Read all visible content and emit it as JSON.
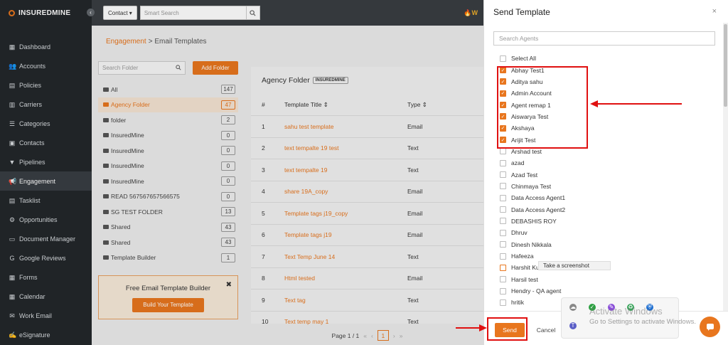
{
  "app": {
    "logo_bold": "INSUREDMINE",
    "logo_thin": "",
    "collapse_icon": "chevron-left"
  },
  "sidebar": {
    "items": [
      {
        "label": "Dashboard",
        "icon": "dashboard-icon",
        "glyph": "▦"
      },
      {
        "label": "Accounts",
        "icon": "users-icon",
        "glyph": "👥"
      },
      {
        "label": "Policies",
        "icon": "document-icon",
        "glyph": "▤"
      },
      {
        "label": "Carriers",
        "icon": "building-icon",
        "glyph": "▥"
      },
      {
        "label": "Categories",
        "icon": "category-icon",
        "glyph": "☰"
      },
      {
        "label": "Contacts",
        "icon": "contact-icon",
        "glyph": "▣"
      },
      {
        "label": "Pipelines",
        "icon": "funnel-icon",
        "glyph": "▼"
      },
      {
        "label": "Engagement",
        "icon": "megaphone-icon",
        "glyph": "📢"
      },
      {
        "label": "Tasklist",
        "icon": "tasklist-icon",
        "glyph": "▤"
      },
      {
        "label": "Opportunities",
        "icon": "opportunity-icon",
        "glyph": "⚙"
      },
      {
        "label": "Document Manager",
        "icon": "folder-icon",
        "glyph": "▭"
      },
      {
        "label": "Google Reviews",
        "icon": "google-icon",
        "glyph": "G"
      },
      {
        "label": "Forms",
        "icon": "forms-icon",
        "glyph": "▦"
      },
      {
        "label": "Calendar",
        "icon": "calendar-icon",
        "glyph": "▦"
      },
      {
        "label": "Work Email",
        "icon": "email-icon",
        "glyph": "✉"
      },
      {
        "label": "eSignature",
        "icon": "signature-icon",
        "glyph": "✍"
      }
    ],
    "active_index": 7
  },
  "topbar": {
    "contact_select": "Contact",
    "search_placeholder": "Smart Search",
    "right_text": "W"
  },
  "breadcrumb": {
    "link": "Engagement",
    "separator": ">",
    "current": "Email Templates"
  },
  "folders": {
    "search_placeholder": "Search Folder",
    "add_label": "Add Folder",
    "items": [
      {
        "name": "All",
        "count": "147"
      },
      {
        "name": "Agency Folder",
        "count": "47"
      },
      {
        "name": "folder",
        "count": "2"
      },
      {
        "name": "InsuredMine",
        "count": "0"
      },
      {
        "name": "InsuredMine",
        "count": "0"
      },
      {
        "name": "InsuredMine",
        "count": "0"
      },
      {
        "name": "InsuredMine",
        "count": "0"
      },
      {
        "name": "READ 567567657566575",
        "count": "0"
      },
      {
        "name": "SG TEST FOLDER",
        "count": "13"
      },
      {
        "name": "Shared",
        "count": "43"
      },
      {
        "name": "Shared",
        "count": "43"
      },
      {
        "name": "Template Builder",
        "count": "1"
      }
    ],
    "selected_index": 1
  },
  "promo": {
    "title": "Free Email Template Builder",
    "button": "Build Your Template",
    "close": "✖"
  },
  "templates": {
    "folder_title": "Agency Folder",
    "folder_badge": "INSUREDMINE",
    "headers": {
      "num": "#",
      "title": "Template Title ⇕",
      "type": "Type ⇕"
    },
    "rows": [
      {
        "n": "1",
        "title": "sahu test template",
        "type": "Email"
      },
      {
        "n": "2",
        "title": "text tempalte 19 test",
        "type": "Text"
      },
      {
        "n": "3",
        "title": "text tempalte 19",
        "type": "Text"
      },
      {
        "n": "4",
        "title": "share 19A_copy",
        "type": "Email"
      },
      {
        "n": "5",
        "title": "Template tags j19_copy",
        "type": "Email"
      },
      {
        "n": "6",
        "title": "Template tags j19",
        "type": "Email"
      },
      {
        "n": "7",
        "title": "Text Temp June 14",
        "type": "Text"
      },
      {
        "n": "8",
        "title": "Html tested",
        "type": "Email"
      },
      {
        "n": "9",
        "title": "Text tag",
        "type": "Text"
      },
      {
        "n": "10",
        "title": "Text temp may 1",
        "type": "Text"
      }
    ]
  },
  "pager": {
    "label": "Page 1 / 1",
    "first": "«",
    "prev": "‹",
    "current": "1",
    "next": "›",
    "last": "»"
  },
  "drawer": {
    "title": "Send Template",
    "close": "×",
    "search_placeholder": "Search Agents",
    "agents": [
      {
        "name": "Select All",
        "checked": false
      },
      {
        "name": "Abhay Test1",
        "checked": true
      },
      {
        "name": "Aditya sahu",
        "checked": true
      },
      {
        "name": "Admin Account",
        "checked": true
      },
      {
        "name": "Agent remap 1",
        "checked": true
      },
      {
        "name": "Aiswarya Test",
        "checked": true
      },
      {
        "name": "Akshaya",
        "checked": true
      },
      {
        "name": "Arijit Test",
        "checked": true
      },
      {
        "name": "Arshad test",
        "checked": false
      },
      {
        "name": "azad",
        "checked": false
      },
      {
        "name": "Azad Test",
        "checked": false
      },
      {
        "name": "Chinmaya Test",
        "checked": false
      },
      {
        "name": "Data Access Agent1",
        "checked": false
      },
      {
        "name": "Data Access Agent2",
        "checked": false
      },
      {
        "name": "DEBASHIS ROY",
        "checked": false
      },
      {
        "name": "Dhruv",
        "checked": false
      },
      {
        "name": "Dinesh Nikkala",
        "checked": false
      },
      {
        "name": "Hafeeza",
        "checked": false
      },
      {
        "name": "Harshit Kudeshia",
        "checked": false
      },
      {
        "name": "Harsil test",
        "checked": false
      },
      {
        "name": "Hendry - QA agent",
        "checked": false
      },
      {
        "name": "hritik",
        "checked": false
      }
    ],
    "send_label": "Send",
    "cancel_label": "Cancel"
  },
  "overlay": {
    "tooltip": "Take a screenshot",
    "activate_title": "Activate Windows",
    "activate_sub": "Go to Settings to activate Windows."
  },
  "colors": {
    "accent": "#e8761e",
    "sidebar_bg": "#23272b",
    "annotation_red": "#e01010"
  }
}
